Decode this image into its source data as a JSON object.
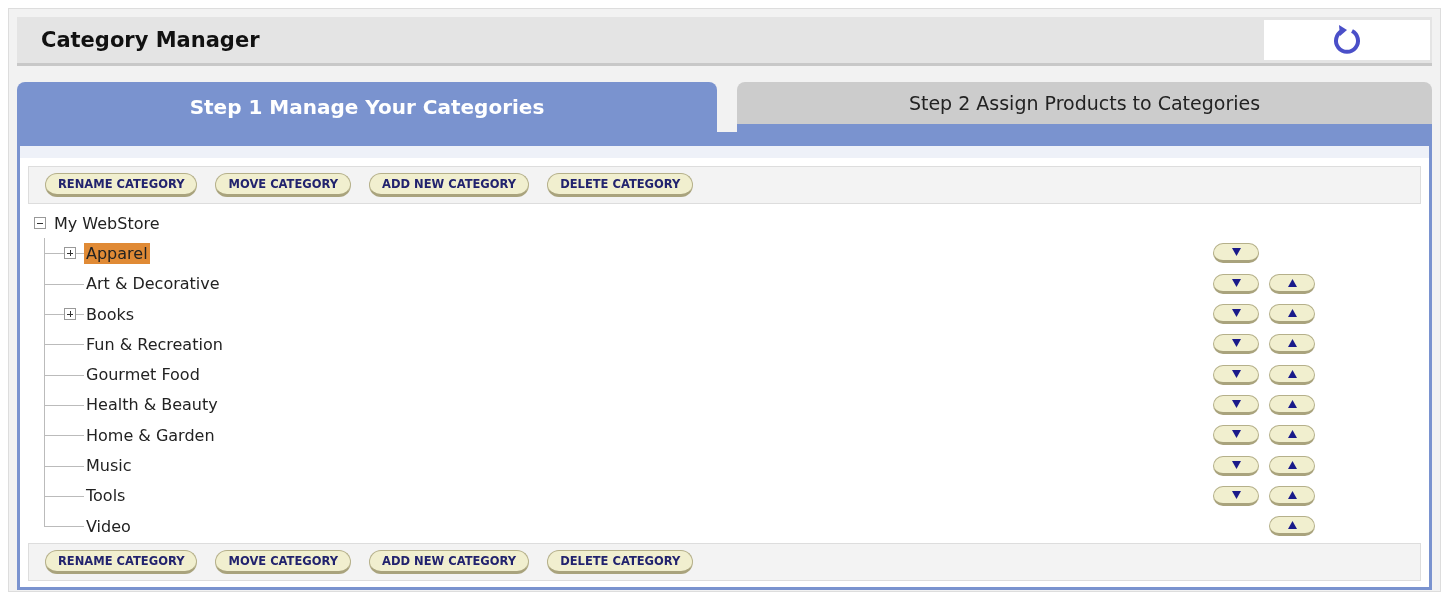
{
  "window": {
    "title": "Category Manager"
  },
  "tabs": [
    {
      "label": "Step 1 Manage Your Categories",
      "selected": true
    },
    {
      "label": "Step 2 Assign Products to Categories",
      "selected": false
    }
  ],
  "toolbar_top": [
    "RENAME CATEGORY",
    "MOVE CATEGORY",
    "ADD NEW CATEGORY",
    "DELETE CATEGORY"
  ],
  "tree": {
    "label": "My WebStore",
    "expanded": true,
    "children": [
      {
        "label": "Apparel",
        "expanded": false,
        "selected": true,
        "move_down": true,
        "move_up": false
      },
      {
        "label": "Art & Decorative",
        "selected": false,
        "move_down": true,
        "move_up": true
      },
      {
        "label": "Books",
        "expanded": false,
        "selected": false,
        "move_down": true,
        "move_up": true
      },
      {
        "label": "Fun & Recreation",
        "selected": false,
        "move_down": true,
        "move_up": true
      },
      {
        "label": "Gourmet Food",
        "selected": false,
        "move_down": true,
        "move_up": true
      },
      {
        "label": "Health & Beauty",
        "selected": false,
        "move_down": true,
        "move_up": true
      },
      {
        "label": "Home & Garden",
        "selected": false,
        "move_down": true,
        "move_up": true
      },
      {
        "label": "Music",
        "selected": false,
        "move_down": true,
        "move_up": true
      },
      {
        "label": "Tools",
        "selected": false,
        "move_down": true,
        "move_up": true
      },
      {
        "label": "Video",
        "selected": false,
        "move_down": false,
        "move_up": true
      }
    ]
  },
  "toolbar_bottom": [
    "RENAME CATEGORY",
    "MOVE CATEGORY",
    "ADD NEW CATEGORY",
    "DELETE CATEGORY"
  ]
}
